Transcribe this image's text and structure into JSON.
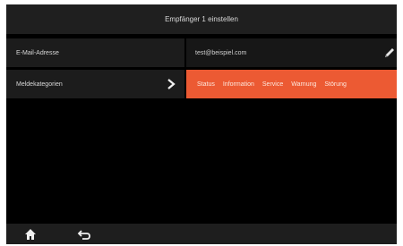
{
  "header": {
    "title": "Empfänger 1 einstellen"
  },
  "email_row": {
    "label": "E-Mail-Adresse",
    "value": "test@beispiel.com",
    "edit_icon": "pencil-icon"
  },
  "category_row": {
    "label": "Meldekategorien",
    "chevron_icon": "chevron-right-icon",
    "categories": [
      "Status",
      "Information",
      "Service",
      "Warnung",
      "Störung"
    ]
  },
  "footer": {
    "home_icon": "home-icon",
    "back_icon": "back-arrow-icon"
  },
  "colors": {
    "accent": "#ec5a33",
    "background": "#000000",
    "panel": "#1c1c1c"
  }
}
